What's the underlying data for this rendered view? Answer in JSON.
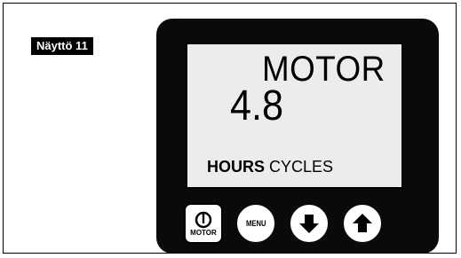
{
  "screen_label": "Näyttö 11",
  "display": {
    "title": "MOTOR",
    "value": "4.8",
    "unit_hours": "HOURS",
    "unit_cycles": "CYCLES"
  },
  "buttons": {
    "motor_label": "MOTOR",
    "menu_label": "MENU"
  },
  "colors": {
    "device_body": "#0a0a0a",
    "lcd_background": "#ececec",
    "label_background": "#000000"
  }
}
